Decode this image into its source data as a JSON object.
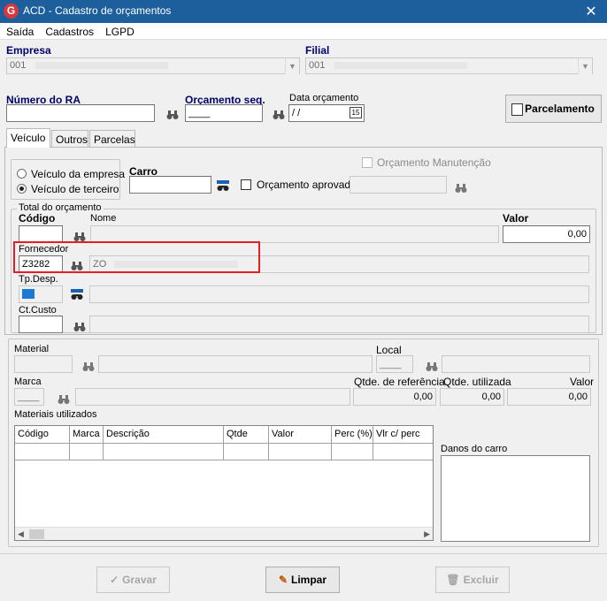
{
  "window": {
    "title": "ACD - Cadastro de orçamentos",
    "app_icon_letter": "G",
    "close_glyph": "✕"
  },
  "menu": [
    "Saída",
    "Cadastros",
    "LGPD"
  ],
  "empresa": {
    "label": "Empresa",
    "value": "001"
  },
  "filial": {
    "label": "Filial",
    "value": "001"
  },
  "numero_ra": {
    "label": "Número do RA",
    "value": ""
  },
  "orcamento_seq": {
    "label": "Orçamento seq.",
    "value": "____"
  },
  "data_orcamento": {
    "label": "Data orçamento",
    "value": " / /",
    "calendar_glyph": "15"
  },
  "parcelamento_button": "Parcelamento",
  "tabs": [
    "Veículo",
    "Outros",
    "Parcelas"
  ],
  "veiculo": {
    "radio_empresa": "Veículo da empresa",
    "radio_terceiro": "Veículo de terceiro",
    "carro_label": "Carro",
    "orcamento_aprovado": "Orçamento aprovado",
    "orcamento_manutencao": "Orçamento Manutenção"
  },
  "total": {
    "group_title": "Total do orçamento",
    "codigo_label": "Código",
    "nome_label": "Nome",
    "valor_label": "Valor",
    "valor_value": "0,00",
    "fornecedor_label": "Fornecedor",
    "fornecedor_code": "Z3282",
    "fornecedor_name_prefix": "ZO",
    "tpdesp_label": "Tp.Desp.",
    "ctcusto_label": "Ct.Custo"
  },
  "material": {
    "material_label": "Material",
    "local_label": "Local",
    "local_value": "____",
    "marca_label": "Marca",
    "marca_value": "____",
    "qtde_referencia_label": "Qtde. de referência",
    "qtde_referencia_value": "0,00",
    "qtde_utilizada_label": "Qtde. utilizada",
    "qtde_utilizada_value": "0,00",
    "valor_label": "Valor",
    "valor_value": "0,00",
    "materiais_utilizados_label": "Materiais utilizados",
    "grid_columns": [
      "Código",
      "Marca",
      "Descrição",
      "Qtde",
      "Valor",
      "Perc (%)",
      "Vlr c/ perc"
    ],
    "danos_label": "Danos do carro"
  },
  "buttons": {
    "gravar": "Gravar",
    "limpar": "Limpar",
    "excluir": "Excluir"
  },
  "colors": {
    "titlebar": "#1d5e9c",
    "label_blue": "#00006e",
    "highlight_red": "#e31f26",
    "tpdesp_swatch": "#1a7ad4"
  }
}
